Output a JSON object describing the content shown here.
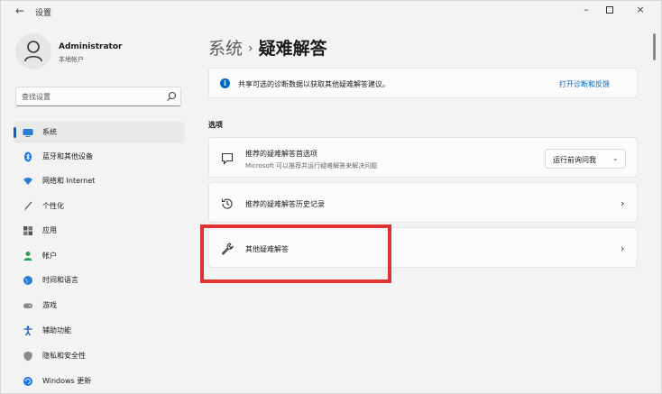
{
  "titlebar": {
    "back": "←",
    "title": "设置",
    "minimize": "–",
    "close": "×"
  },
  "profile": {
    "name": "Administrator",
    "account": "本地帐户"
  },
  "search": {
    "placeholder": "查找设置"
  },
  "sidebar": {
    "items": [
      {
        "label": "系统",
        "icon": "system-icon",
        "selected": true
      },
      {
        "label": "蓝牙和其他设备",
        "icon": "bluetooth-icon"
      },
      {
        "label": "网络和 Internet",
        "icon": "network-icon"
      },
      {
        "label": "个性化",
        "icon": "brush-icon"
      },
      {
        "label": "应用",
        "icon": "apps-icon"
      },
      {
        "label": "帐户",
        "icon": "account-icon"
      },
      {
        "label": "时间和语言",
        "icon": "globe-icon"
      },
      {
        "label": "游戏",
        "icon": "gamepad-icon"
      },
      {
        "label": "辅助功能",
        "icon": "accessibility-icon"
      },
      {
        "label": "隐私和安全性",
        "icon": "shield-icon"
      },
      {
        "label": "Windows 更新",
        "icon": "update-icon"
      }
    ]
  },
  "breadcrumb": {
    "parent": "系统",
    "separator": "›",
    "current": "疑难解答"
  },
  "info": {
    "text": "共享可选的诊断数据以获取其他疑难解答建议。",
    "link": "打开诊断和反馈"
  },
  "section": {
    "title": "选项"
  },
  "options": {
    "preferences": {
      "title": "推荐的疑难解答首选项",
      "subtitle": "Microsoft 可以推荐并运行疑难解答来解决问题",
      "dropdown_value": "运行前询问我"
    },
    "history": {
      "title": "推荐的疑难解答历史记录",
      "chevron": "›"
    },
    "other": {
      "title": "其他疑难解答",
      "chevron": "›"
    }
  },
  "colors": {
    "accent": "#0067c0",
    "highlight": "#e03232"
  }
}
